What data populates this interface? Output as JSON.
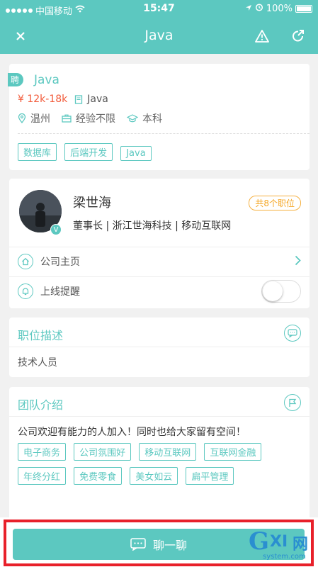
{
  "status_bar": {
    "carrier": "中国移动",
    "time": "15:47",
    "battery": "100%"
  },
  "nav": {
    "title": "Java"
  },
  "job": {
    "badge": "聘",
    "title": "Java",
    "salary": "¥ 12k-18k",
    "category": "Java",
    "location": "温州",
    "experience": "经验不限",
    "education": "本科",
    "tags": [
      "数据库",
      "后端开发",
      "Java"
    ]
  },
  "recruiter": {
    "name": "梁世海",
    "job_count": "共8个职位",
    "info": "董事长 | 浙江世海科技 | 移动互联网",
    "verified": "V",
    "company_home": "公司主页",
    "online_alert": "上线提醒"
  },
  "description": {
    "title": "职位描述",
    "text": "技术人员"
  },
  "team": {
    "title": "团队介绍",
    "text": "公司欢迎有能力的人加入！同时也给大家留有空间！",
    "tags": [
      "电子商务",
      "公司氛围好",
      "移动互联网",
      "互联网金融",
      "年终分红",
      "免费零食",
      "美女如云",
      "扁平管理"
    ]
  },
  "chat_button": {
    "label": "聊一聊"
  },
  "watermark": {
    "brand_g": "G",
    "brand_xi": "XI",
    "brand_net": "网",
    "url": "system.com"
  },
  "colors": {
    "accent": "#5cc8c0",
    "salary": "#f25c3c",
    "job_count": "#f5a623",
    "highlight_frame": "#e8202a"
  }
}
